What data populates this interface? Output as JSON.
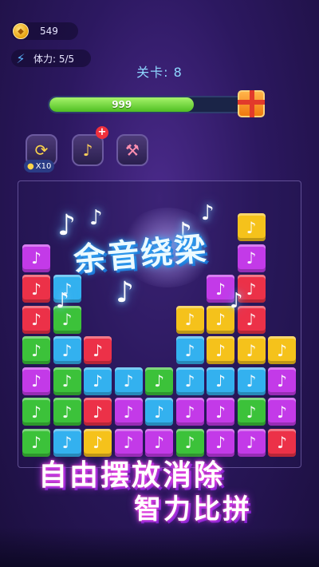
{
  "hud": {
    "coins": "549",
    "coin_icon": "coin-icon",
    "stamina_label": "体力: 5/5",
    "stamina_icon": "lightning-icon"
  },
  "level": {
    "label": "关卡: 8"
  },
  "progress": {
    "text": "999",
    "fraction": 0.72
  },
  "tools": {
    "refresh_count": "X10",
    "icons": [
      "refresh-icon",
      "music-bomb-icon",
      "hammer-icon"
    ]
  },
  "combo_text": "余音绕梁",
  "slogan": {
    "line1": "自由摆放消除",
    "line2": "智力比拼"
  },
  "colors": {
    "purple": "#c33ae8",
    "red": "#ec3148",
    "green": "#3cc23a",
    "blue": "#33b1ef",
    "yellow": "#f5c21b"
  },
  "board": {
    "cols": 9,
    "rows": 9,
    "cells": [
      "....................................",
      "",
      "",
      "",
      "",
      "",
      "",
      "",
      ""
    ],
    "grid": [
      [
        null,
        null,
        null,
        null,
        null,
        null,
        null,
        "yellow",
        null
      ],
      [
        "purple",
        null,
        null,
        null,
        null,
        null,
        null,
        "purple",
        null
      ],
      [
        "red",
        "blue",
        null,
        null,
        null,
        null,
        "purple",
        "red",
        null
      ],
      [
        "red",
        "green",
        null,
        null,
        null,
        "yellow",
        "yellow",
        "red",
        null
      ],
      [
        "green",
        "blue",
        "red",
        null,
        null,
        "blue",
        "yellow",
        "yellow",
        "yellow"
      ],
      [
        "purple",
        "green",
        "blue",
        "blue",
        "green",
        "blue",
        "blue",
        "blue",
        "purple"
      ],
      [
        "green",
        "green",
        "red",
        "purple",
        "blue",
        "purple",
        "purple",
        "green",
        "purple"
      ],
      [
        "green",
        "blue",
        "yellow",
        "purple",
        "purple",
        "green",
        "purple",
        "purple",
        "red"
      ]
    ]
  }
}
